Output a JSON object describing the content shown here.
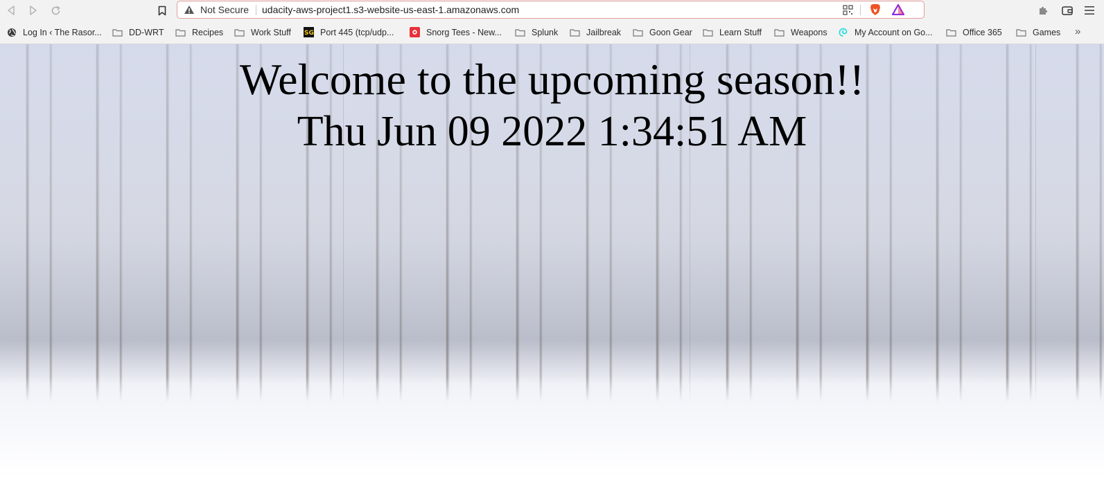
{
  "browser": {
    "url_warning": "Not Secure",
    "url": "udacity-aws-project1.s3-website-us-east-1.amazonaws.com"
  },
  "bookmarks": [
    {
      "label": "Log In ‹ The Rasor...",
      "icon": "globe-icon"
    },
    {
      "label": "DD-WRT",
      "icon": "folder-icon"
    },
    {
      "label": "Recipes",
      "icon": "folder-icon"
    },
    {
      "label": "Work Stuff",
      "icon": "folder-icon"
    },
    {
      "label": "Port 445 (tcp/udp...",
      "icon": "speedguide-icon"
    },
    {
      "label": "Snorg Tees - New...",
      "icon": "snorg-icon"
    },
    {
      "label": "Splunk",
      "icon": "folder-icon"
    },
    {
      "label": "Jailbreak",
      "icon": "folder-icon"
    },
    {
      "label": "Goon Gear",
      "icon": "folder-icon"
    },
    {
      "label": "Learn Stuff",
      "icon": "folder-icon"
    },
    {
      "label": "Weapons",
      "icon": "folder-icon"
    },
    {
      "label": "My Account on Go...",
      "icon": "godaddy-icon"
    },
    {
      "label": "Office 365",
      "icon": "folder-icon"
    },
    {
      "label": "Games",
      "icon": "folder-icon"
    }
  ],
  "page": {
    "heading": "Welcome to the upcoming season!!",
    "datetime": "Thu Jun 09 2022 1:34:51 AM"
  }
}
